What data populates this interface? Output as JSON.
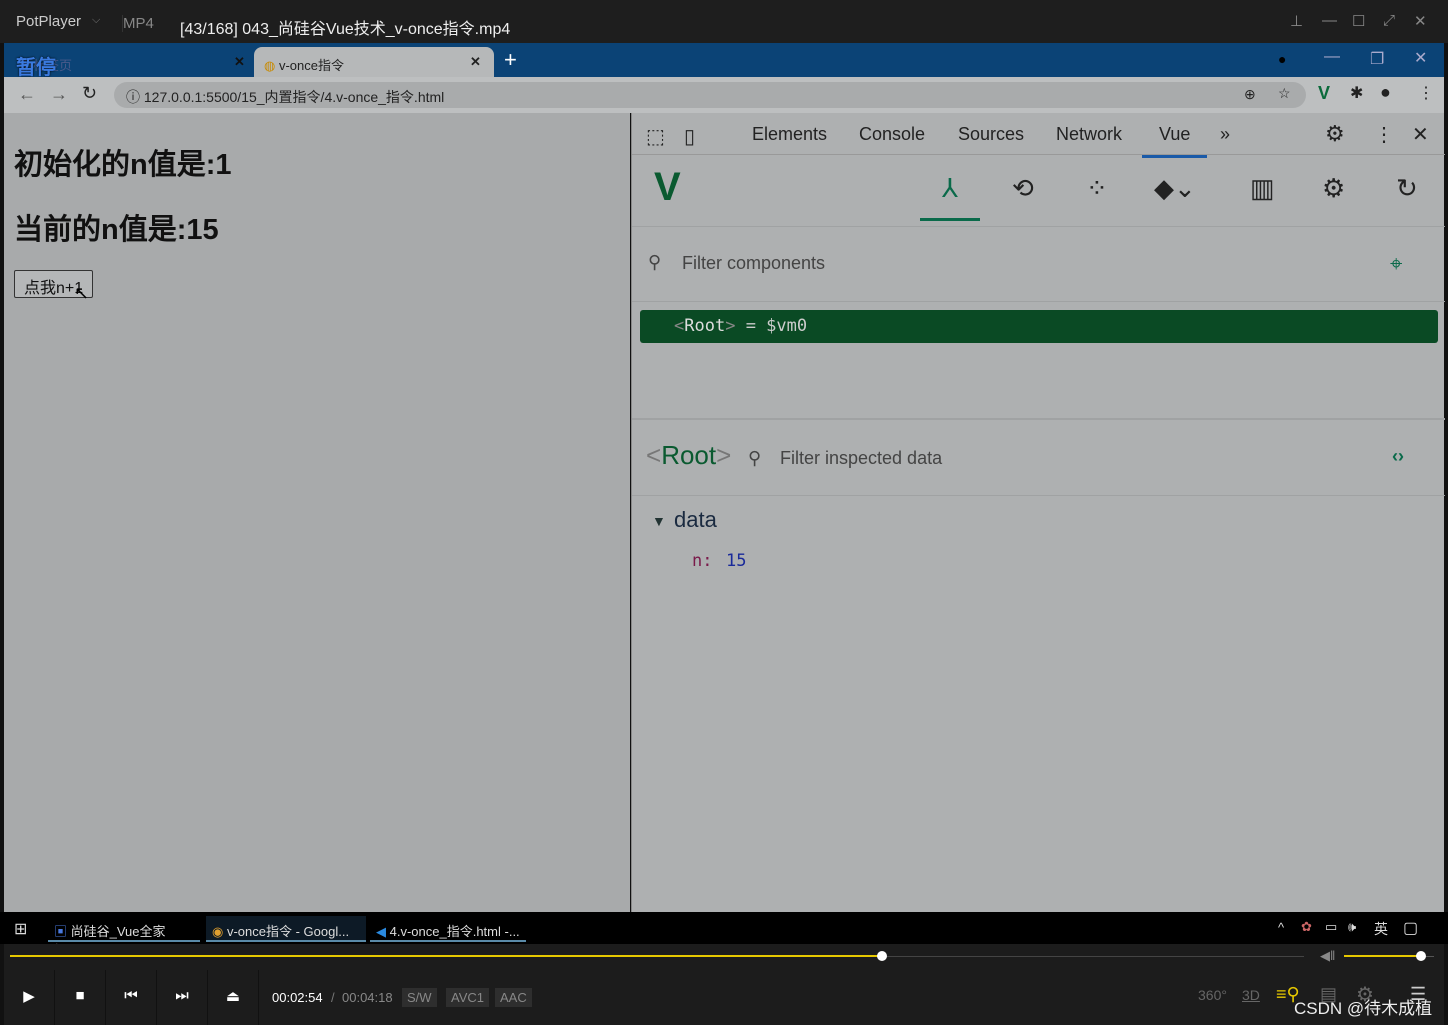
{
  "player": {
    "logo": "PotPlayer",
    "format": "MP4",
    "title": "[43/168] 043_尚硅谷Vue技术_v-once指令.mp4",
    "osd": "暂停",
    "time_current": "00:02:54",
    "time_total": "00:04:18",
    "badges": [
      "S/W",
      "AVC1",
      "AAC"
    ],
    "progress": 0.674,
    "volume": 0.85,
    "accent": "#e6c800",
    "watermark": "CSDN @待木成植",
    "right_buttons": [
      "360°",
      "3D"
    ]
  },
  "browser": {
    "tabs": [
      {
        "label": "新标签页"
      },
      {
        "label": "v-once指令"
      }
    ],
    "url": "127.0.0.1:5500/15_内置指令/4.v-once_指令.html"
  },
  "page": {
    "initial": "初始化的n值是:1",
    "current": "当前的n值是:15",
    "button": "点我n+1"
  },
  "devtools": {
    "tabs": [
      "Elements",
      "Console",
      "Sources",
      "Network",
      "Vue"
    ],
    "active_tab": "Vue",
    "filter_placeholder": "Filter components",
    "root_tag": "Root",
    "root_var": "= $vm0",
    "inspect_placeholder": "Filter inspected data",
    "section": "data",
    "prop_key": "n:",
    "prop_value": "15",
    "vue_green": "#0a4a24"
  },
  "taskbar": {
    "items": [
      "尚硅谷_Vue全家桶.d...",
      "v-once指令 - Googl...",
      "4.v-once_指令.html -..."
    ],
    "ime": "英"
  }
}
